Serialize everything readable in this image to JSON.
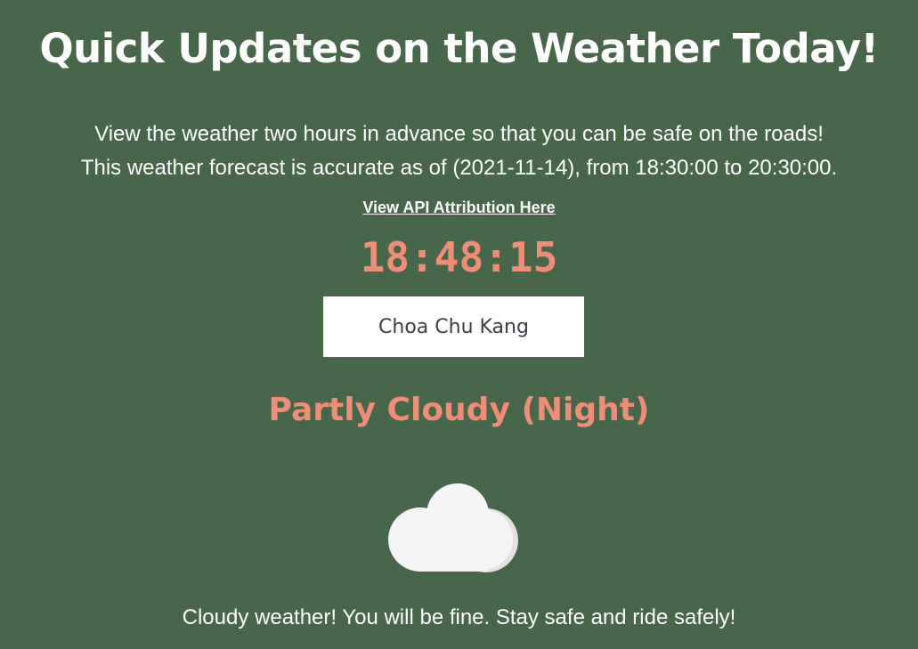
{
  "header": {
    "title": "Quick Updates on the Weather Today!",
    "subtitle_line1": "View the weather two hours in advance so that you can be safe on the roads!",
    "subtitle_line2": "This weather forecast is accurate as of (2021-11-14), from 18:30:00 to 20:30:00.",
    "api_link_label": "View API Attribution Here"
  },
  "clock": {
    "time": "18:48:15"
  },
  "location": {
    "selected": "Choa Chu Kang"
  },
  "forecast": {
    "condition": "Partly Cloudy (Night)",
    "icon": "cloud-icon",
    "message": "Cloudy weather! You will be fine. Stay safe and ride safely!"
  },
  "colors": {
    "background": "#47664a",
    "accent": "#ee8e78",
    "text": "#ffffff"
  }
}
